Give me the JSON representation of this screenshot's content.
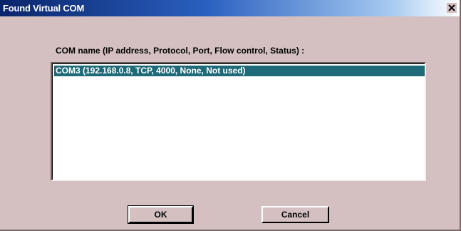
{
  "window": {
    "title": "Found Virtual COM",
    "close_symbol": "×"
  },
  "list": {
    "label": "COM name (IP address, Protocol, Port, Flow control, Status) :",
    "items": [
      {
        "text": "COM3 (192.168.0.8, TCP, 4000, None, Not used)",
        "selected": true
      }
    ]
  },
  "buttons": {
    "ok_label": "OK",
    "cancel_label": "Cancel"
  },
  "colors": {
    "title_bar_start": "#0a246a",
    "window_face": "#d4c0c0",
    "selection": "#1f6a78"
  },
  "icons": {
    "close": "close-icon"
  }
}
